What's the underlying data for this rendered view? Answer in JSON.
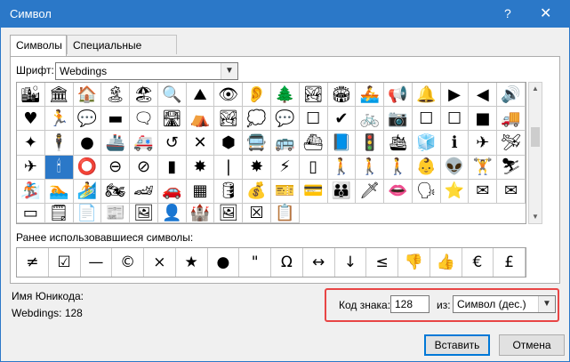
{
  "window": {
    "title": "Символ",
    "help": "?",
    "close": "✕"
  },
  "tabs": [
    {
      "label": "Символы"
    },
    {
      "label": "Специальные знаки"
    }
  ],
  "font": {
    "label": "Шрифт:",
    "value": "Webdings"
  },
  "grid": {
    "symbols": [
      "🏙",
      "🏛",
      "🏠",
      "🏝",
      "🏖",
      "🔍",
      "⛰",
      "👁",
      "👂",
      "🌲",
      "🏞",
      "🏟",
      "🚣",
      "📢",
      "🔔",
      "▶",
      "◀",
      "🔊",
      "♥",
      "🏃",
      "💬",
      "▬",
      "🗨",
      "🛣",
      "⛺",
      "🏞",
      "💭",
      "💬",
      "☐",
      "✔",
      "🚲",
      "📷",
      "☐",
      "☐",
      "■",
      "🚚",
      "✦",
      "🕴",
      "●",
      "🚢",
      "🚑",
      "↺",
      "✕",
      "⬢",
      "🚍",
      "🚌",
      "⛴",
      "📘",
      "🚦",
      "🛳",
      "🧊",
      "ℹ",
      "✈",
      "🛩",
      "✈",
      "🕯",
      "⭕",
      "⊖",
      "⊘",
      "▮",
      "✸",
      "❘",
      "✸",
      "⚡",
      "▯",
      "🚶",
      "🚶",
      "🚶",
      "👶",
      "👽",
      "🏋",
      "⛷",
      "🏂",
      "🏊",
      "🏄",
      "🏍",
      "🏎",
      "🚗",
      "▦",
      "🛢",
      "💰",
      "🎫",
      "💳",
      "👪",
      "🗡",
      "👄",
      "🗣",
      "⭐",
      "✉",
      "✉",
      "▭",
      "🗒",
      "📄",
      "📰",
      "🖼",
      "👤",
      "🏰",
      "🖼",
      "☒",
      "📋"
    ],
    "selected_index": 55
  },
  "recent": {
    "label": "Ранее использовавшиеся символы:",
    "symbols": [
      "≠",
      "☑",
      "—",
      "©",
      "×",
      "★",
      "●",
      "\"",
      "Ω",
      "↔",
      "↓",
      "≤",
      "👎",
      "👍",
      "€",
      "£",
      "¥",
      "©",
      "®"
    ]
  },
  "unicode": {
    "label": "Имя Юникода:",
    "value": "Webdings: 128"
  },
  "code": {
    "label": "Код знака:",
    "value": "128",
    "from_label": "из:",
    "from_value": "Символ (дес.)"
  },
  "buttons": {
    "insert": "Вставить",
    "cancel": "Отмена"
  }
}
